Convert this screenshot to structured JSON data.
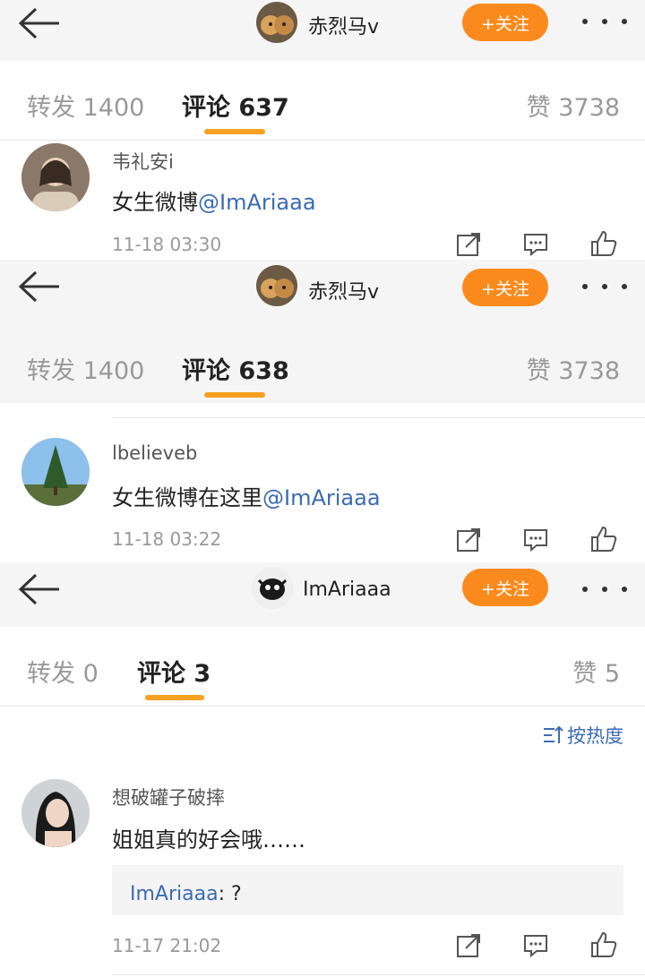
{
  "panels": [
    {
      "header": {
        "username": "赤烈马v",
        "follow": "+关注"
      },
      "tabs": {
        "repost": "转发 1400",
        "comments": "评论 637",
        "likes": "赞 3738"
      },
      "comment": {
        "user": "韦礼安i",
        "text": "女生微博",
        "mention": "@ImAriaaa",
        "time": "11-18 03:30"
      }
    },
    {
      "header": {
        "username": "赤烈马v",
        "follow": "+关注"
      },
      "tabs": {
        "repost": "转发 1400",
        "comments": "评论 638",
        "likes": "赞 3738"
      },
      "comment": {
        "user": "lbelieveb",
        "text": "女生微博在这里",
        "mention": "@ImAriaaa",
        "time": "11-18 03:22"
      }
    },
    {
      "header": {
        "username": "ImAriaaa",
        "follow": "+关注"
      },
      "tabs": {
        "repost": "转发 0",
        "comments": "评论 3",
        "likes": "赞 5"
      },
      "sort": "按热度",
      "comment": {
        "user": "想破罐子破摔",
        "text": "姐姐真的好会哦……",
        "time": "11-17 21:02",
        "reply": {
          "user": "ImAriaaa",
          "text": ": ?"
        }
      }
    }
  ],
  "colors": {
    "accent": "#fb8a1d",
    "link": "#3b6bb3",
    "underline": "#f7a021"
  },
  "icons": [
    "back-arrow-icon",
    "more-icon",
    "repost-icon",
    "comment-icon",
    "like-icon",
    "sort-icon"
  ]
}
